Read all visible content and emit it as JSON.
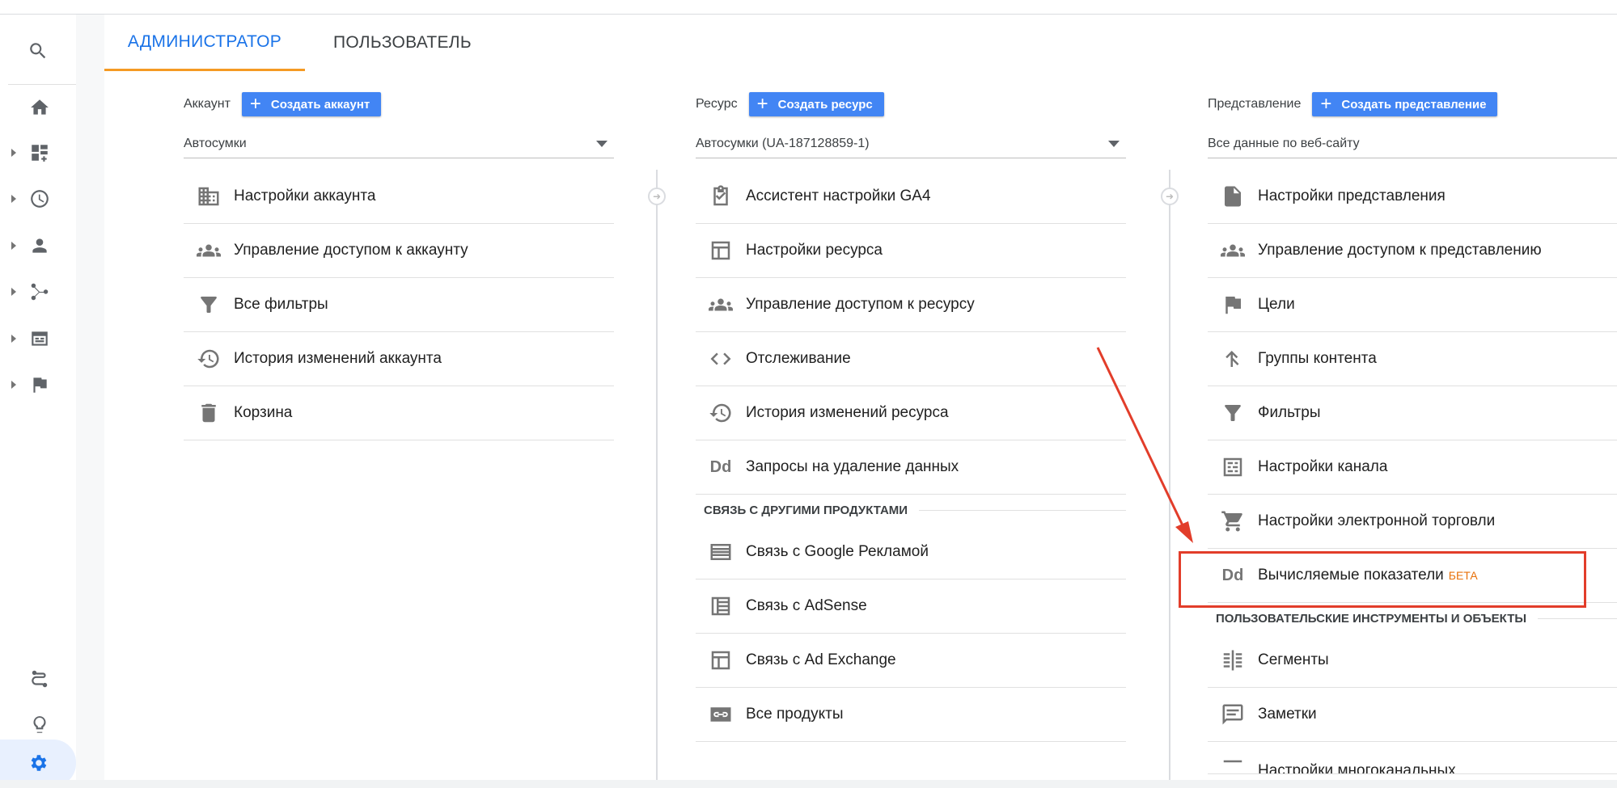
{
  "tabs": {
    "admin": "АДМИНИСТРАТОР",
    "user": "ПОЛЬЗОВАТЕЛЬ"
  },
  "columns": [
    {
      "label": "Аккаунт",
      "create_button": "Создать аккаунт",
      "selected": "Автосумки",
      "items": [
        {
          "label": "Настройки аккаунта",
          "icon": "building-icon"
        },
        {
          "label": "Управление доступом к аккаунту",
          "icon": "people-icon"
        },
        {
          "label": "Все фильтры",
          "icon": "filter-icon"
        },
        {
          "label": "История изменений аккаунта",
          "icon": "history-icon"
        },
        {
          "label": "Корзина",
          "icon": "trash-icon"
        }
      ]
    },
    {
      "label": "Ресурс",
      "create_button": "Создать ресурс",
      "selected": "Автосумки (UA-187128859-1)",
      "items": [
        {
          "label": "Ассистент настройки GA4",
          "icon": "clipboard-check-icon"
        },
        {
          "label": "Настройки ресурса",
          "icon": "layout-icon"
        },
        {
          "label": "Управление доступом к ресурсу",
          "icon": "people-icon"
        },
        {
          "label": "Отслеживание",
          "icon": "code-icon"
        },
        {
          "label": "История изменений ресурса",
          "icon": "history-icon"
        },
        {
          "label": "Запросы на удаление данных",
          "icon": "dd-icon",
          "glyph": "Dd"
        }
      ],
      "section": "СВЯЗЬ С ДРУГИМИ ПРОДУКТАМИ",
      "section_items": [
        {
          "label": "Связь с Google Рекламой",
          "icon": "ads-icon"
        },
        {
          "label": "Связь с AdSense",
          "icon": "adsense-icon"
        },
        {
          "label": "Связь с Ad Exchange",
          "icon": "adexchange-icon"
        },
        {
          "label": "Все продукты",
          "icon": "link-icon"
        }
      ]
    },
    {
      "label": "Представление",
      "create_button": "Создать представление",
      "selected": "Все данные по веб-сайту",
      "items": [
        {
          "label": "Настройки представления",
          "icon": "document-icon"
        },
        {
          "label": "Управление доступом к представлению",
          "icon": "people-icon"
        },
        {
          "label": "Цели",
          "icon": "flag-icon"
        },
        {
          "label": "Группы контента",
          "icon": "content-group-icon"
        },
        {
          "label": "Фильтры",
          "icon": "filter-icon"
        },
        {
          "label": "Настройки канала",
          "icon": "channel-icon"
        },
        {
          "label": "Настройки электронной торговли",
          "icon": "cart-icon"
        },
        {
          "label": "Вычисляемые показатели",
          "icon": "dd-icon",
          "glyph": "Dd",
          "badge": "БЕТА"
        }
      ],
      "section": "ПОЛЬЗОВАТЕЛЬСКИЕ ИНСТРУМЕНТЫ И ОБЪЕКТЫ",
      "section_items": [
        {
          "label": "Сегменты",
          "icon": "segments-icon"
        },
        {
          "label": "Заметки",
          "icon": "notes-icon"
        },
        {
          "label": "Настройки многоканальных",
          "icon": "multichannel-icon"
        }
      ]
    }
  ],
  "annotation": {
    "color": "#e23d2a"
  }
}
